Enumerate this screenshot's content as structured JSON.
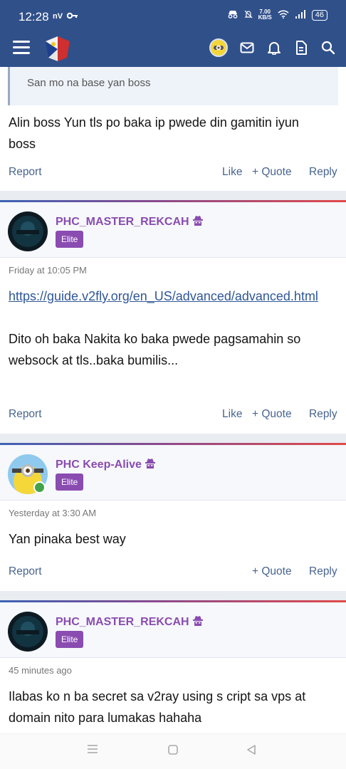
{
  "status": {
    "time": "12:28",
    "carrier": "nV",
    "speed_value": "7.00",
    "speed_unit": "KB/S",
    "battery": "46"
  },
  "icons": {
    "menu": "hamburger-icon",
    "logo": "forum-logo-icon",
    "mail": "mail-icon",
    "bell": "bell-icon",
    "doc": "document-icon",
    "search": "search-icon"
  },
  "posts": [
    {
      "quote": "San mo na base yan boss",
      "body": [
        "Alin boss Yun tls po baka ip pwede din gamitin iyun",
        "boss"
      ],
      "actions": {
        "report": "Report",
        "like": "Like",
        "quote": "+ Quote",
        "reply": "Reply"
      }
    },
    {
      "user": "PHC_MASTER_REKCAH",
      "badge": "Elite",
      "date": "Friday at 10:05 PM",
      "link": "https://guide.v2fly.org/en_US/advanced/advanced.html",
      "body": [
        "Dito oh baka Nakita ko baka pwede pagsamahin so",
        "websock at tls..baka bumilis..."
      ],
      "actions": {
        "report": "Report",
        "like": "Like",
        "quote": "+ Quote",
        "reply": "Reply"
      }
    },
    {
      "user": "PHC Keep-Alive",
      "badge": "Elite",
      "date": "Yesterday at 3:30 AM",
      "body": [
        "Yan pinaka best way"
      ],
      "actions": {
        "report": "Report",
        "quote": "+ Quote",
        "reply": "Reply"
      }
    },
    {
      "user": "PHC_MASTER_REKCAH",
      "badge": "Elite",
      "date": "45 minutes ago",
      "body": [
        "Ilabas ko n ba secret sa v2ray using s cript sa vps at",
        "domain nito para lumakas hahaha"
      ]
    }
  ]
}
